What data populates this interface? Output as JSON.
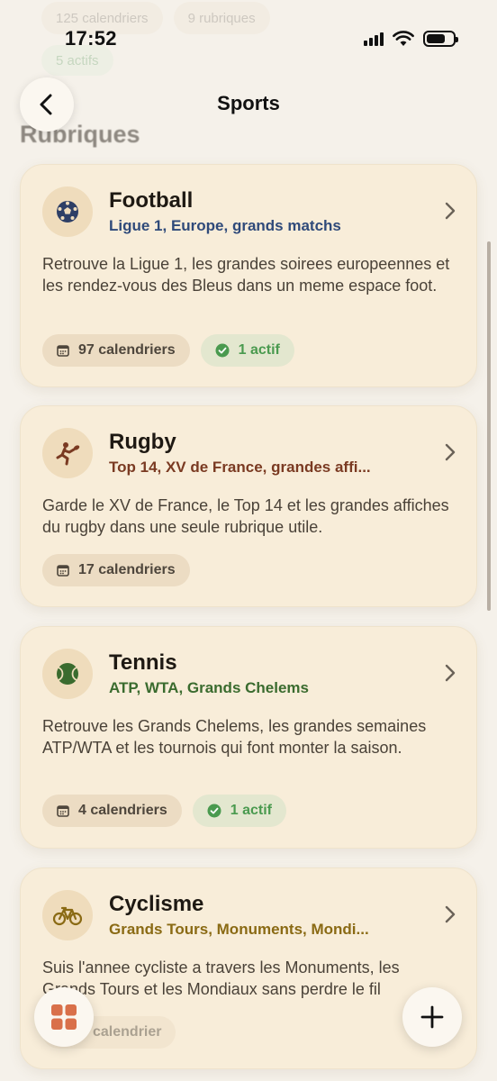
{
  "status_bar": {
    "time": "17:52"
  },
  "background": {
    "chip_calendars": "125 calendriers",
    "chip_rubriques": "9 rubriques",
    "chip_active": "5 actifs",
    "section_heading": "Rubriques"
  },
  "nav": {
    "title": "Sports"
  },
  "cards": [
    {
      "title": "Football",
      "subtitle": "Ligue 1, Europe, grands matchs",
      "subtitle_color": "#2f4a7a",
      "icon": "soccer-ball-icon",
      "description": "Retrouve la Ligue 1, les grandes soirees europeennes et les rendez-vous des Bleus dans un meme espace foot.",
      "calendars": "97 calendriers",
      "active": "1 actif"
    },
    {
      "title": "Rugby",
      "subtitle": "Top 14, XV de France, grandes affi...",
      "subtitle_color": "#7a3a22",
      "icon": "rugby-player-icon",
      "description": "Garde le XV de France, le Top 14 et les grandes affiches du rugby dans une seule rubrique utile.",
      "calendars": "17 calendriers"
    },
    {
      "title": "Tennis",
      "subtitle": "ATP, WTA, Grands Chelems",
      "subtitle_color": "#3a6b2e",
      "icon": "tennis-ball-icon",
      "description": "Retrouve les Grands Chelems, les grandes semaines ATP/WTA et les tournois qui font monter la saison.",
      "calendars": "4 calendriers",
      "active": "1 actif"
    },
    {
      "title": "Cyclisme",
      "subtitle": "Grands Tours, Monuments, Mondi...",
      "subtitle_color": "#8a6a14",
      "icon": "bicycle-icon",
      "description": "Suis l'annee cycliste a travers les Monuments, les Grands Tours et les Mondiaux sans perdre le fil",
      "calendars": "calendrier"
    }
  ],
  "colors": {
    "background": "#f5f1ea",
    "card": "#f8edd9",
    "accent": "#d9704a",
    "active_green": "#4a9a4f"
  }
}
